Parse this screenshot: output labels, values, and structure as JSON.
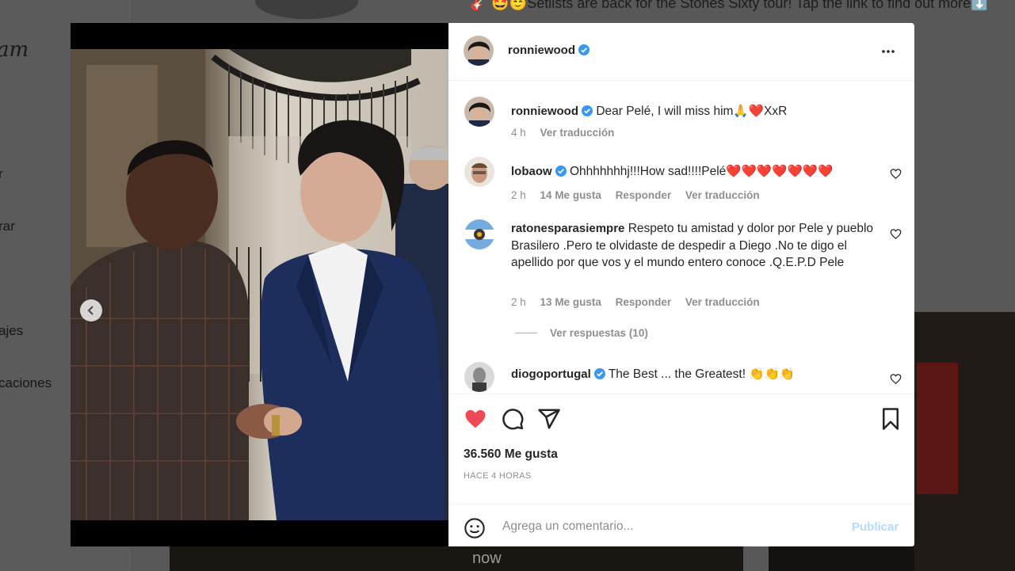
{
  "background": {
    "logo_fragment": "am",
    "nav_fragments": [
      "r",
      "rar",
      "ajes",
      "caciones"
    ],
    "top_post_text": "🎸 🤩😇Setlists are back for the Stones Sixty tour! Tap the link to find out more⬇️",
    "bottom_fragment": "now"
  },
  "post": {
    "author": "ronniewood",
    "photo_position": "3 of 3",
    "caption": {
      "username": "ronniewood",
      "text": "Dear Pelé, I will miss him🙏❤️XxR",
      "time": "4 h",
      "translate": "Ver traducción"
    },
    "comments": [
      {
        "username": "lobaow",
        "verified": true,
        "text": "Ohhhhhhhj!!!How sad!!!!Pelé❤️❤️❤️❤️❤️❤️❤️",
        "time": "2 h",
        "likes": "14 Me gusta",
        "reply": "Responder",
        "translate": "Ver traducción"
      },
      {
        "username": "ratonesparasiempre",
        "verified": false,
        "text": "Respeto tu amistad y dolor por Pele y pueblo Brasilero .Pero te olvidaste de despedir a Diego .No te digo el apellido por que vos y el mundo entero conoce .Q.E.P.D Pele",
        "time": "2 h",
        "likes": "13 Me gusta",
        "reply": "Responder",
        "translate": "Ver traducción",
        "view_replies": "Ver respuestas (10)"
      },
      {
        "username": "diogoportugal",
        "verified": true,
        "text": "The Best ... the Greatest! 👏👏👏"
      }
    ],
    "likes": "36.560 Me gusta",
    "time_ago": "HACE 4 HORAS",
    "comment_placeholder": "Agrega un comentario...",
    "publish_label": "Publicar"
  },
  "icons": {
    "more": "more-options-icon",
    "heart": "heart-icon",
    "comment": "comment-icon",
    "share": "share-icon",
    "save": "bookmark-icon",
    "emoji": "emoji-icon",
    "verified": "verified-badge-icon",
    "prev": "chevron-left-icon"
  },
  "colors": {
    "like_red": "#ed4956",
    "verified_blue": "#3897f0",
    "publish_disabled": "#b3dbff"
  }
}
